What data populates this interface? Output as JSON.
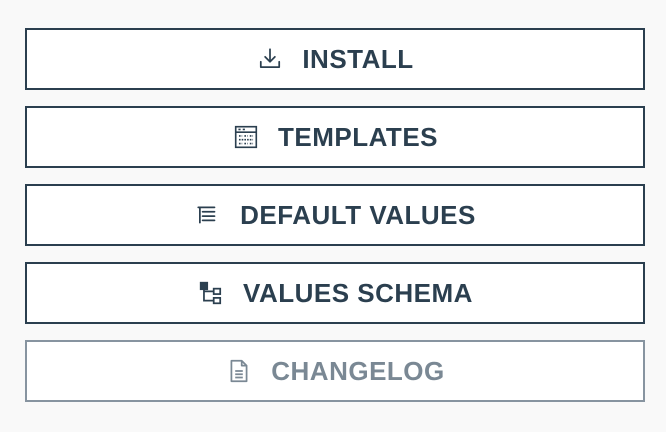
{
  "buttons": [
    {
      "label": "INSTALL",
      "icon": "download-icon",
      "enabled": true
    },
    {
      "label": "TEMPLATES",
      "icon": "templates-icon",
      "enabled": true
    },
    {
      "label": "DEFAULT VALUES",
      "icon": "list-tree-icon",
      "enabled": true
    },
    {
      "label": "VALUES SCHEMA",
      "icon": "schema-icon",
      "enabled": true
    },
    {
      "label": "CHANGELOG",
      "icon": "document-icon",
      "enabled": false
    }
  ],
  "colors": {
    "primary": "#2b3f4f",
    "disabled": "#7a8894",
    "background": "#f9f9f9"
  }
}
